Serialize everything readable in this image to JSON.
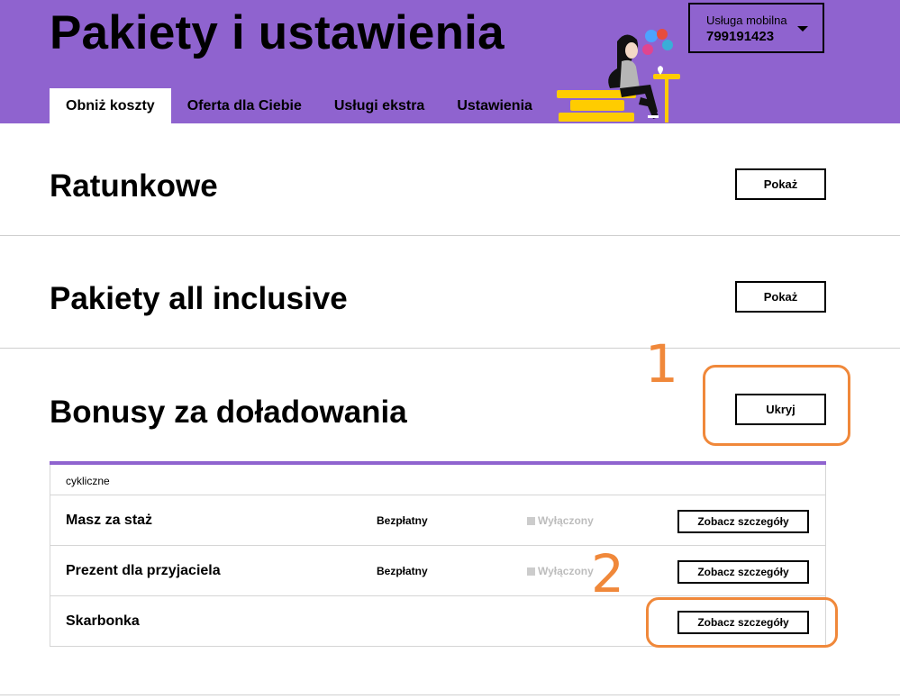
{
  "colors": {
    "brand": "#8f63cf",
    "annotation": "#f0883a",
    "illustration_yellow": "#ffcc00"
  },
  "header": {
    "title": "Pakiety i ustawienia",
    "tabs": [
      {
        "label": "Obniż koszty",
        "active": true
      },
      {
        "label": "Oferta dla Ciebie",
        "active": false
      },
      {
        "label": "Usługi ekstra",
        "active": false
      },
      {
        "label": "Ustawienia",
        "active": false
      }
    ],
    "service": {
      "label": "Usługa mobilna",
      "number": "799191423",
      "icon": "chevron-down-icon"
    }
  },
  "sections": [
    {
      "title": "Ratunkowe",
      "button": "Pokaż"
    },
    {
      "title": "Pakiety all inclusive",
      "button": "Pokaż"
    },
    {
      "title": "Bonusy za doładowania",
      "button": "Ukryj"
    }
  ],
  "bonuses_table": {
    "group": "cykliczne",
    "rows": [
      {
        "name": "Masz za staż",
        "price": "Bezpłatny",
        "status": "Wyłączony",
        "button": "Zobacz szczegóły"
      },
      {
        "name": "Prezent dla przyjaciela",
        "price": "Bezpłatny",
        "status": "Wyłączony",
        "button": "Zobacz szczegóły"
      },
      {
        "name": "Skarbonka",
        "price": "",
        "status": "",
        "button": "Zobacz szczegóły"
      }
    ]
  },
  "annotations": {
    "one": "1",
    "two": "2"
  }
}
